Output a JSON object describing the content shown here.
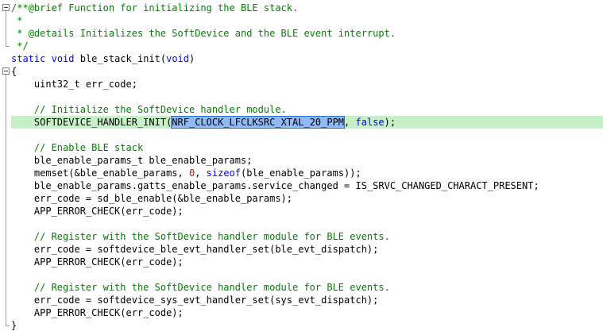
{
  "editor": {
    "lines": [
      [
        {
          "t": "/**@brief Function for initializing the BLE stack.",
          "c": "comment"
        }
      ],
      [
        {
          "t": " *",
          "c": "comment"
        }
      ],
      [
        {
          "t": " * @details Initializes the SoftDevice and the BLE event interrupt.",
          "c": "comment"
        }
      ],
      [
        {
          "t": " */",
          "c": "comment"
        }
      ],
      [
        {
          "t": "static",
          "c": "keyword"
        },
        {
          "t": " ",
          "c": "plain"
        },
        {
          "t": "void",
          "c": "keyword"
        },
        {
          "t": " ble_stack_init(",
          "c": "plain"
        },
        {
          "t": "void",
          "c": "keyword"
        },
        {
          "t": ")",
          "c": "plain"
        }
      ],
      [
        {
          "t": "{",
          "c": "plain"
        }
      ],
      [
        {
          "t": "    uint32_t err_code;",
          "c": "plain"
        }
      ],
      [
        {
          "t": "",
          "c": "plain"
        }
      ],
      [
        {
          "t": "    // Initialize the SoftDevice handler module.",
          "c": "comment"
        }
      ],
      [
        {
          "t": "    SOFTDEVICE_HANDLER_INIT(",
          "c": "plain"
        },
        {
          "t": "NRF_CLOCK_LFCLKSRC_XTAL_20_PPM",
          "c": "selection"
        },
        {
          "t": ", ",
          "c": "plain"
        },
        {
          "t": "false",
          "c": "keyword"
        },
        {
          "t": ");",
          "c": "plain"
        }
      ],
      [
        {
          "t": "",
          "c": "plain"
        }
      ],
      [
        {
          "t": "    // Enable BLE stack",
          "c": "comment"
        }
      ],
      [
        {
          "t": "    ble_enable_params_t ble_enable_params;",
          "c": "plain"
        }
      ],
      [
        {
          "t": "    memset(&ble_enable_params, ",
          "c": "plain"
        },
        {
          "t": "0",
          "c": "number"
        },
        {
          "t": ", ",
          "c": "plain"
        },
        {
          "t": "sizeof",
          "c": "keyword"
        },
        {
          "t": "(ble_enable_params));",
          "c": "plain"
        }
      ],
      [
        {
          "t": "    ble_enable_params.gatts_enable_params.service_changed = IS_SRVC_CHANGED_CHARACT_PRESENT;",
          "c": "plain"
        }
      ],
      [
        {
          "t": "    err_code = sd_ble_enable(&ble_enable_params);",
          "c": "plain"
        }
      ],
      [
        {
          "t": "    APP_ERROR_CHECK(err_code);",
          "c": "plain"
        }
      ],
      [
        {
          "t": "",
          "c": "plain"
        }
      ],
      [
        {
          "t": "    // Register with the SoftDevice handler module for BLE events.",
          "c": "comment"
        }
      ],
      [
        {
          "t": "    err_code = softdevice_ble_evt_handler_set(ble_evt_dispatch);",
          "c": "plain"
        }
      ],
      [
        {
          "t": "    APP_ERROR_CHECK(err_code);",
          "c": "plain"
        }
      ],
      [
        {
          "t": "",
          "c": "plain"
        }
      ],
      [
        {
          "t": "    // Register with the SoftDevice handler module for BLE events.",
          "c": "comment"
        }
      ],
      [
        {
          "t": "    err_code = softdevice_sys_evt_handler_set(sys_evt_dispatch);",
          "c": "plain"
        }
      ],
      [
        {
          "t": "    APP_ERROR_CHECK(err_code);",
          "c": "plain"
        }
      ],
      [
        {
          "t": "}",
          "c": "plain"
        }
      ]
    ],
    "highlighted_line": 9
  }
}
